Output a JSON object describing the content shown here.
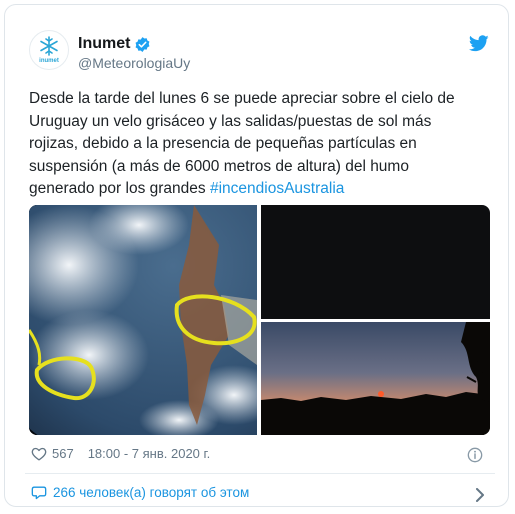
{
  "tweet": {
    "author": {
      "name": "Inumet",
      "handle": "@MeteorologiaUy",
      "avatar_text": "inumet",
      "verified": true
    },
    "text": "Desde la tarde del lunes 6 se puede apreciar sobre el cielo de Uruguay un velo grisáceo y las salidas/puestas de sol más rojizas, debido a la presencia de pequeñas partículas en suspensión (a más de 6000 metros de altura) del humo generado por los grandes ",
    "hashtag": "#incendiosAustralia",
    "media": [
      {
        "kind": "satellite-image"
      },
      {
        "kind": "night-sky-photo"
      },
      {
        "kind": "sunset-photo"
      }
    ],
    "likes": "567",
    "timestamp": "18:00 - 7 янв. 2020 г.",
    "conversation": "266 человек(а) говорят об этом",
    "colors": {
      "accent": "#1b95e0",
      "text": "#14171a",
      "muted": "#657786",
      "twitter_blue": "#1da1f2"
    }
  }
}
